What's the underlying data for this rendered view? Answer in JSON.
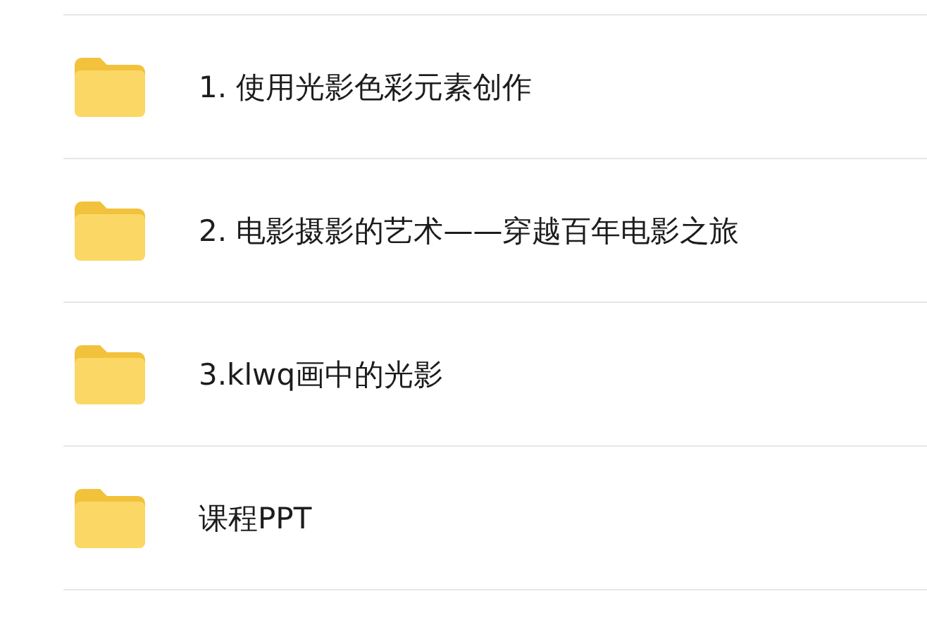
{
  "folders": [
    {
      "name": "1. 使用光影色彩元素创作"
    },
    {
      "name": "2. 电影摄影的艺术——穿越百年电影之旅"
    },
    {
      "name": "3.klwq画中的光影"
    },
    {
      "name": "课程PPT"
    }
  ]
}
